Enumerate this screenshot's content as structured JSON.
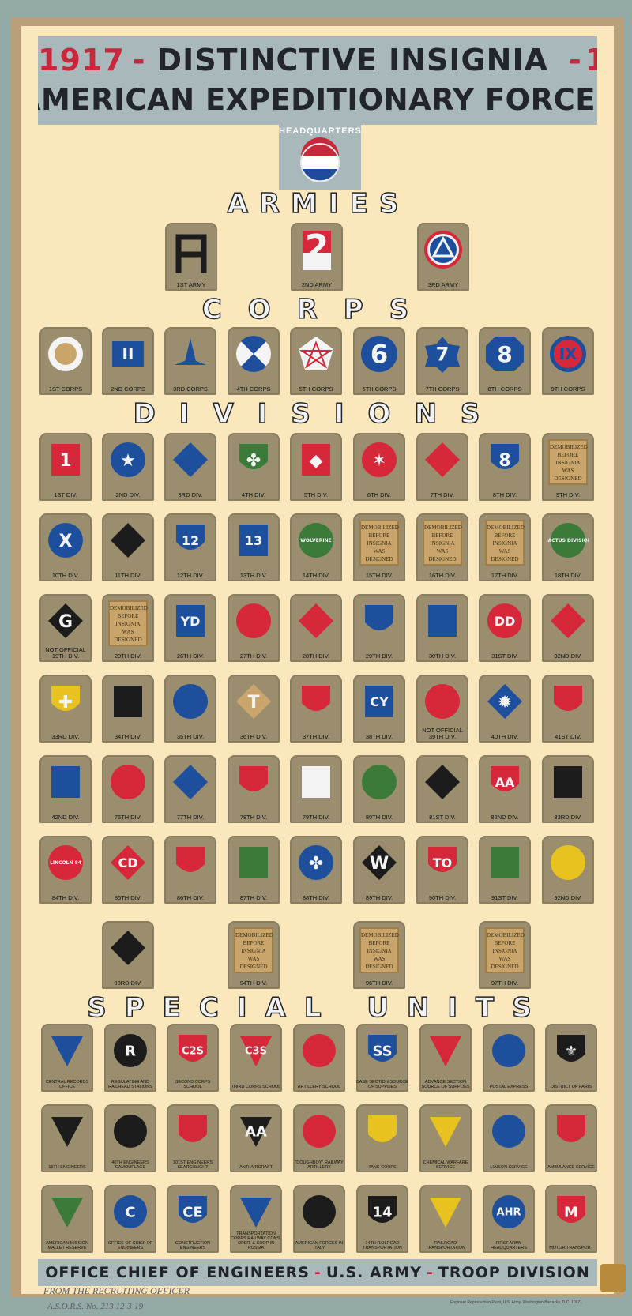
{
  "title": {
    "year_start": "1917",
    "dash1": "-",
    "middle": "DISTINCTIVE INSIGNIA",
    "dash2": "-",
    "year_end": "1919",
    "subtitle": "AMERICAN EXPEDITIONARY FORCES"
  },
  "headquarters": "HEADQUARTERS",
  "sections": {
    "armies": "ARMIES",
    "corps": "CORPS",
    "divisions": "DIVISIONS",
    "special": "SPECIAL UNITS"
  },
  "demobilized_text": "DEMOBILIZED BEFORE INSIGNIA WAS DESIGNED",
  "armies": [
    {
      "label": "1ST ARMY",
      "glyph": "A"
    },
    {
      "label": "2ND ARMY",
      "glyph": "2"
    },
    {
      "label": "3RD ARMY",
      "glyph": "A"
    }
  ],
  "corps": [
    {
      "label": "1ST CORPS",
      "glyph": ""
    },
    {
      "label": "2ND CORPS",
      "glyph": "II"
    },
    {
      "label": "3RD CORPS",
      "glyph": ""
    },
    {
      "label": "4TH CORPS",
      "glyph": ""
    },
    {
      "label": "5TH CORPS",
      "glyph": ""
    },
    {
      "label": "6TH CORPS",
      "glyph": "6"
    },
    {
      "label": "7TH CORPS",
      "glyph": "7"
    },
    {
      "label": "8TH CORPS",
      "glyph": "8"
    },
    {
      "label": "9TH CORPS",
      "glyph": "IX"
    }
  ],
  "divisions": [
    {
      "label": "1ST DIV.",
      "glyph": "1"
    },
    {
      "label": "2ND DIV.",
      "glyph": "★"
    },
    {
      "label": "3RD DIV.",
      "glyph": ""
    },
    {
      "label": "4TH DIV.",
      "glyph": "✤"
    },
    {
      "label": "5TH DIV.",
      "glyph": "◆"
    },
    {
      "label": "6TH DIV.",
      "glyph": "✶"
    },
    {
      "label": "7TH DIV.",
      "glyph": ""
    },
    {
      "label": "8TH DIV.",
      "glyph": "8"
    },
    {
      "label": "9TH DIV.",
      "glyph": ""
    },
    {
      "label": "10TH DIV.",
      "glyph": "X"
    },
    {
      "label": "11TH DIV.",
      "glyph": ""
    },
    {
      "label": "12TH DIV.",
      "glyph": "12"
    },
    {
      "label": "13TH DIV.",
      "glyph": "13"
    },
    {
      "label": "14TH DIV.",
      "glyph": "WOLVERINE"
    },
    {
      "label": "15TH DIV.",
      "glyph": ""
    },
    {
      "label": "16TH DIV.",
      "glyph": ""
    },
    {
      "label": "17TH DIV.",
      "glyph": ""
    },
    {
      "label": "18TH DIV.",
      "glyph": "CACTUS DIVISION"
    },
    {
      "label": "NOT OFFICIAL 19TH DIV.",
      "glyph": "G"
    },
    {
      "label": "20TH DIV.",
      "glyph": ""
    },
    {
      "label": "26TH DIV.",
      "glyph": "YD"
    },
    {
      "label": "27TH DIV.",
      "glyph": ""
    },
    {
      "label": "28TH DIV.",
      "glyph": ""
    },
    {
      "label": "29TH DIV.",
      "glyph": ""
    },
    {
      "label": "30TH DIV.",
      "glyph": ""
    },
    {
      "label": "31ST DIV.",
      "glyph": "DD"
    },
    {
      "label": "32ND DIV.",
      "glyph": ""
    },
    {
      "label": "33RD DIV.",
      "glyph": "✚"
    },
    {
      "label": "34TH DIV.",
      "glyph": ""
    },
    {
      "label": "35TH DIV.",
      "glyph": ""
    },
    {
      "label": "36TH DIV.",
      "glyph": "T"
    },
    {
      "label": "37TH DIV.",
      "glyph": ""
    },
    {
      "label": "38TH DIV.",
      "glyph": "CY"
    },
    {
      "label": "NOT OFFICIAL 39TH DIV.",
      "glyph": ""
    },
    {
      "label": "40TH DIV.",
      "glyph": "✹"
    },
    {
      "label": "41ST DIV.",
      "glyph": ""
    },
    {
      "label": "42ND DIV.",
      "glyph": ""
    },
    {
      "label": "76TH DIV.",
      "glyph": ""
    },
    {
      "label": "77TH DIV.",
      "glyph": ""
    },
    {
      "label": "78TH DIV.",
      "glyph": ""
    },
    {
      "label": "79TH DIV.",
      "glyph": "✝"
    },
    {
      "label": "80TH DIV.",
      "glyph": ""
    },
    {
      "label": "81ST DIV.",
      "glyph": ""
    },
    {
      "label": "82ND DIV.",
      "glyph": "AA"
    },
    {
      "label": "83RD DIV.",
      "glyph": ""
    },
    {
      "label": "84TH DIV.",
      "glyph": "LINCOLN 84"
    },
    {
      "label": "85TH DIV.",
      "glyph": "CD"
    },
    {
      "label": "86TH DIV.",
      "glyph": ""
    },
    {
      "label": "87TH DIV.",
      "glyph": ""
    },
    {
      "label": "88TH DIV.",
      "glyph": "✤"
    },
    {
      "label": "89TH DIV.",
      "glyph": "W"
    },
    {
      "label": "90TH DIV.",
      "glyph": "TO"
    },
    {
      "label": "91ST DIV.",
      "glyph": ""
    },
    {
      "label": "92ND DIV.",
      "glyph": ""
    },
    {
      "label": "93RD DIV.",
      "glyph": ""
    },
    {
      "label": "94TH DIV.",
      "glyph": ""
    },
    {
      "label": "96TH DIV.",
      "glyph": ""
    },
    {
      "label": "97TH DIV.",
      "glyph": ""
    }
  ],
  "special_units": [
    {
      "label": "CENTRAL RECORDS OFFICE",
      "glyph": ""
    },
    {
      "label": "REGULATING AND RAILHEAD STATIONS",
      "glyph": "R"
    },
    {
      "label": "SECOND CORPS SCHOOL",
      "glyph": "C2S"
    },
    {
      "label": "THIRD CORPS SCHOOL",
      "glyph": "C3S"
    },
    {
      "label": "ARTILLERY SCHOOL",
      "glyph": ""
    },
    {
      "label": "BASE SECTION SOURCE OF SUPPLIES",
      "glyph": "SS"
    },
    {
      "label": "ADVANCE SECTION SOURCE OF SUPPLIES",
      "glyph": ""
    },
    {
      "label": "POSTAL EXPRESS",
      "glyph": ""
    },
    {
      "label": "DISTRICT OF PARIS",
      "glyph": "⚜"
    },
    {
      "label": "15TH ENGINEERS",
      "glyph": ""
    },
    {
      "label": "40TH ENGINEERS CAMOUFLAGE",
      "glyph": ""
    },
    {
      "label": "101ST ENGINEERS SEARCHLIGHT",
      "glyph": ""
    },
    {
      "label": "ANTI-AIRCRAFT",
      "glyph": "AA"
    },
    {
      "label": "\"DOUGHBOY\" RAILWAY ARTILLERY",
      "glyph": ""
    },
    {
      "label": "TANK CORPS",
      "glyph": ""
    },
    {
      "label": "CHEMICAL WARFARE SERVICE",
      "glyph": ""
    },
    {
      "label": "LIAISON SERVICE",
      "glyph": ""
    },
    {
      "label": "AMBULANCE SERVICE",
      "glyph": ""
    },
    {
      "label": "AMERICAN MISSION MALLET RESERVE",
      "glyph": ""
    },
    {
      "label": "OFFICE OF CHIEF OF ENGINEERS",
      "glyph": "C"
    },
    {
      "label": "CONSTRUCTION ENGINEERS",
      "glyph": "CE"
    },
    {
      "label": "TRANSPORTATION CORPS RAILWAY CONS. OPER. & SHOP IN RUSSIA",
      "glyph": ""
    },
    {
      "label": "AMERICAN FORCES IN ITALY",
      "glyph": ""
    },
    {
      "label": "14TH RAILROAD TRANSPORTATION",
      "glyph": "14"
    },
    {
      "label": "RAILROAD TRANSPORTATION",
      "glyph": ""
    },
    {
      "label": "FIRST ARMY HEADQUARTERS",
      "glyph": "AHR"
    },
    {
      "label": "MOTOR TRANSPORT",
      "glyph": "M"
    }
  ],
  "footer": {
    "part1": "OFFICE CHIEF OF ENGINEERS",
    "part2": "U.S. ARMY",
    "part3": "TROOP DIVISION",
    "dash": "-"
  },
  "handwritten": {
    "line1": "FROM THE RECRUITING OFFICER",
    "line2": "A.S.O.R.S. No. 213 12-3-19"
  },
  "credit": "Engineer Reproduction Plant, U.S. Army, Washington Barracks, D.C. 10971"
}
